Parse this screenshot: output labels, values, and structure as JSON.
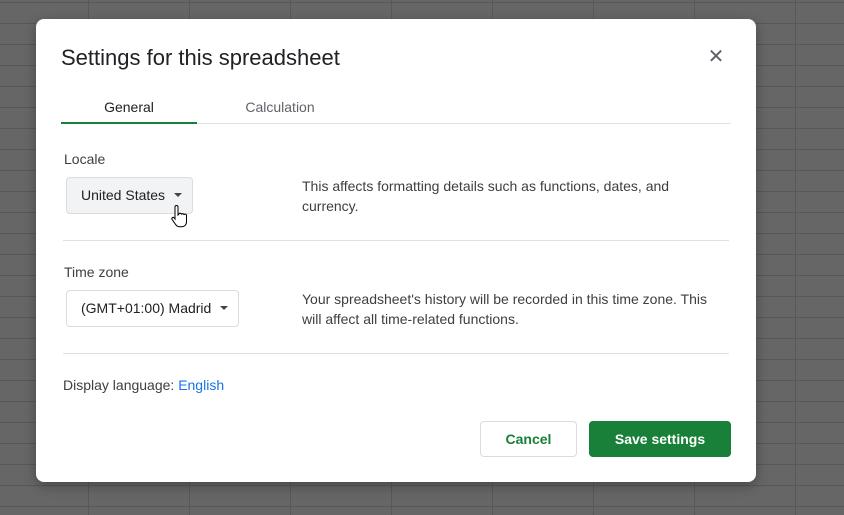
{
  "dialog": {
    "title": "Settings for this spreadsheet",
    "close_icon": "close-icon"
  },
  "tabs": [
    {
      "label": "General",
      "active": true
    },
    {
      "label": "Calculation",
      "active": false
    }
  ],
  "locale": {
    "label": "Locale",
    "value": "United States",
    "description": "This affects formatting details such as functions, dates, and currency."
  },
  "timezone": {
    "label": "Time zone",
    "value": "(GMT+01:00) Madrid",
    "description": "Your spreadsheet's history will be recorded in this time zone. This will affect all time-related functions."
  },
  "display_language": {
    "label": "Display language:",
    "value": "English"
  },
  "buttons": {
    "cancel": "Cancel",
    "save": "Save settings"
  },
  "colors": {
    "accent": "#188038",
    "link": "#1a73e8"
  }
}
